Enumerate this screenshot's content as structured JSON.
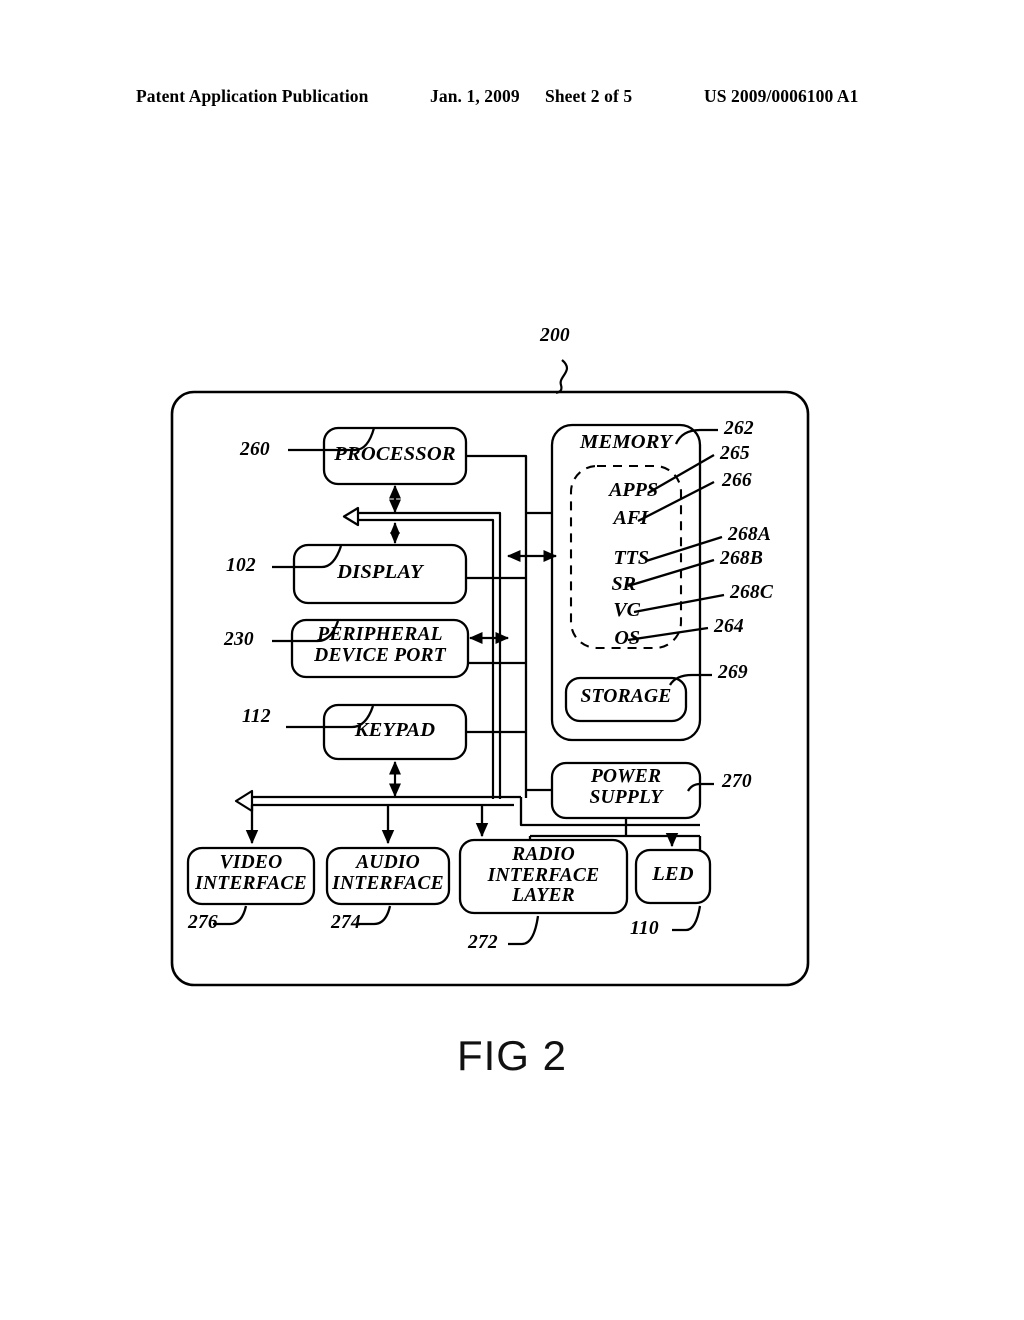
{
  "header": {
    "publication": "Patent Application Publication",
    "date": "Jan. 1, 2009",
    "sheet": "Sheet 2 of 5",
    "patent_number": "US 2009/0006100 A1"
  },
  "figure": {
    "caption": "FIG 2",
    "system_ref": "200",
    "blocks": {
      "processor": {
        "label": "PROCESSOR",
        "ref": "260"
      },
      "display": {
        "label": "DISPLAY",
        "ref": "102"
      },
      "peripheral_device_port": {
        "label": "PERIPHERAL\nDEVICE PORT",
        "ref": "230"
      },
      "keypad": {
        "label": "KEYPAD",
        "ref": "112"
      },
      "memory": {
        "label": "MEMORY",
        "ref": "262"
      },
      "storage": {
        "label": "STORAGE",
        "ref": "269"
      },
      "power_supply": {
        "label": "POWER\nSUPPLY",
        "ref": "270"
      },
      "video_interface": {
        "label": "VIDEO\nINTERFACE",
        "ref": "276"
      },
      "audio_interface": {
        "label": "AUDIO\nINTERFACE",
        "ref": "274"
      },
      "radio_interface_layer": {
        "label": "RADIO\nINTERFACE\nLAYER",
        "ref": "272"
      },
      "led": {
        "label": "LED",
        "ref": "110"
      }
    },
    "memory_modules": [
      {
        "label": "APPS",
        "ref": "265"
      },
      {
        "label": "AFI",
        "ref": "266"
      },
      {
        "label": "TTS",
        "ref": "268A"
      },
      {
        "label": "SR",
        "ref": "268B"
      },
      {
        "label": "VC",
        "ref": "268C"
      },
      {
        "label": "OS",
        "ref": "264"
      }
    ]
  },
  "colors": {
    "ink": "#000000",
    "paper": "#ffffff"
  }
}
